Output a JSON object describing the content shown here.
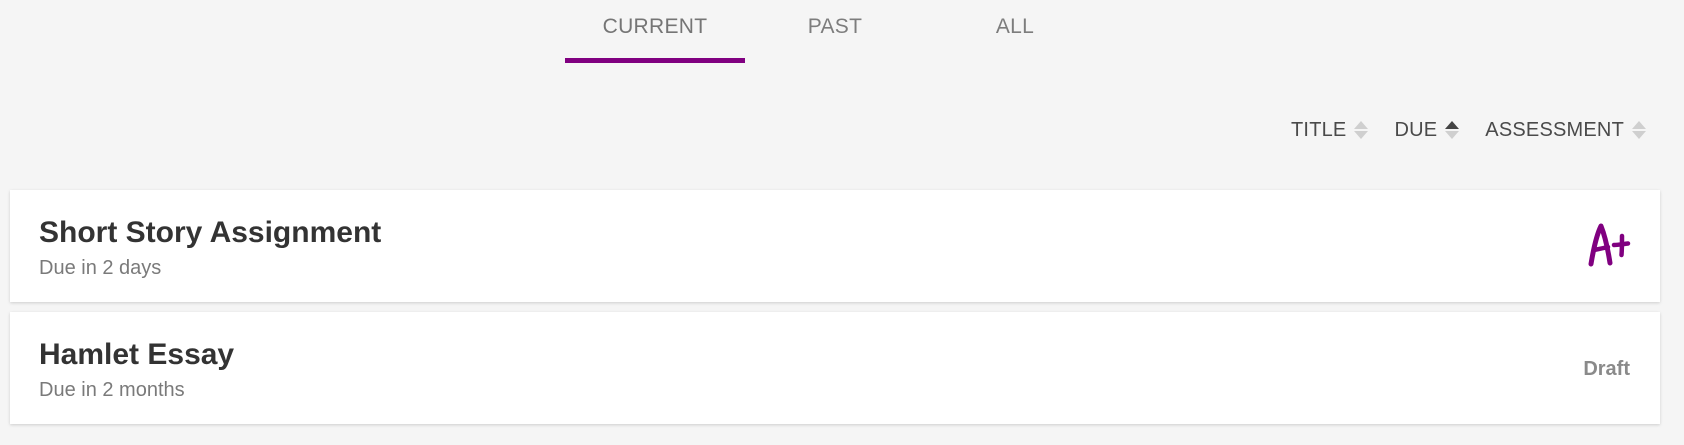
{
  "tabs": [
    {
      "label": "CURRENT",
      "active": true
    },
    {
      "label": "PAST",
      "active": false
    },
    {
      "label": "ALL",
      "active": false
    }
  ],
  "accent_color": "#800080",
  "sort": {
    "columns": [
      {
        "label": "TITLE",
        "state": "unsorted"
      },
      {
        "label": "DUE",
        "state": "ascending"
      },
      {
        "label": "ASSESSMENT",
        "state": "unsorted"
      }
    ]
  },
  "assignments": [
    {
      "title": "Short Story Assignment",
      "due": "Due in 2 days",
      "assessment": "A+",
      "assessment_style": "handwritten-grade"
    },
    {
      "title": "Hamlet Essay",
      "due": "Due in 2 months",
      "assessment": "Draft",
      "assessment_style": "status-text"
    }
  ]
}
